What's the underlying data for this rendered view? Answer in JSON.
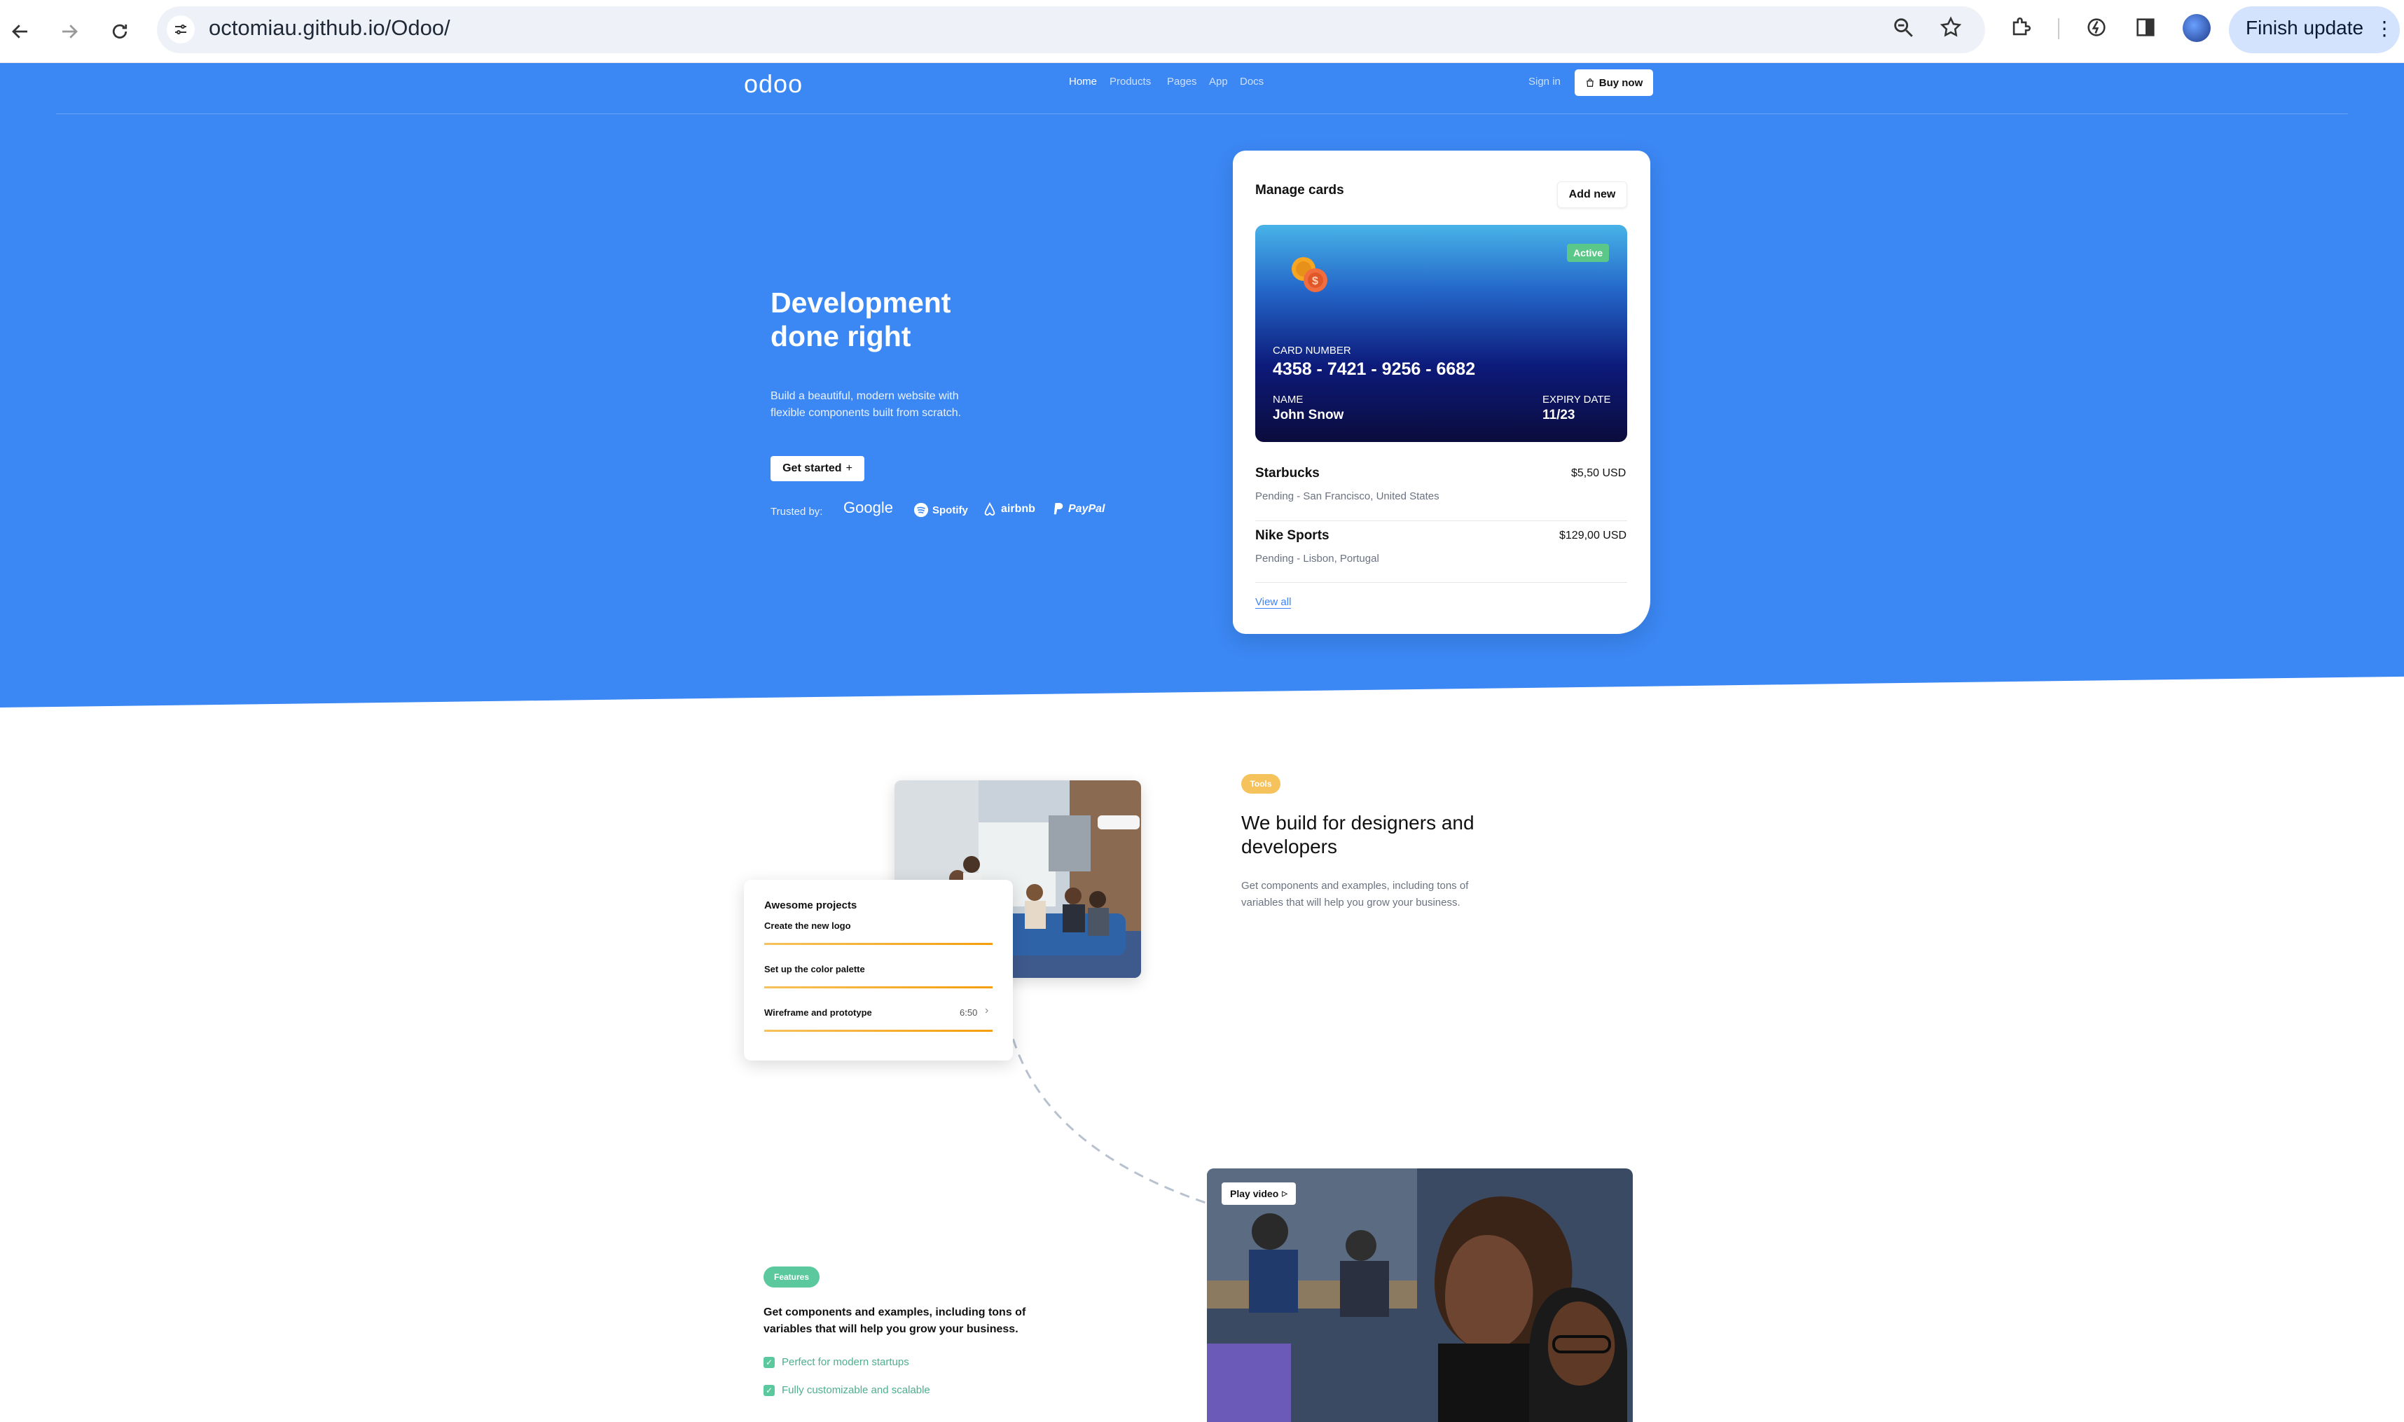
{
  "browser": {
    "url": "octomiau.github.io/Odoo/",
    "finish_update": "Finish update"
  },
  "nav": {
    "logo": "odoo",
    "links": [
      "Home",
      "Products",
      "Pages",
      "App",
      "Docs"
    ],
    "sign_in": "Sign in",
    "buy_now": "Buy now"
  },
  "hero": {
    "title_line1": "Development",
    "title_line2": "done right",
    "subtitle_line1": "Build a beautiful, modern website with",
    "subtitle_line2": "flexible components built from scratch.",
    "cta": "Get started",
    "cta_icon": "+",
    "trusted_label": "Trusted by:",
    "brands": [
      "Google",
      "Spotify",
      "airbnb",
      "PayPal"
    ]
  },
  "manage_cards": {
    "title": "Manage cards",
    "add_new": "Add new",
    "card": {
      "status": "Active",
      "number_label": "CARD NUMBER",
      "number": "4358 - 7421 - 9256 - 6682",
      "name_label": "NAME",
      "name": "John Snow",
      "expiry_label": "EXPIRY DATE",
      "expiry": "11/23"
    },
    "transactions": [
      {
        "merchant": "Starbucks",
        "amount": "$5,50 USD",
        "detail": "Pending - San Francisco, United States"
      },
      {
        "merchant": "Nike Sports",
        "amount": "$129,00 USD",
        "detail": "Pending - Lisbon, Portugal"
      }
    ],
    "view_all": "View all"
  },
  "tools": {
    "badge": "Tools",
    "title_line1": "We build for designers and",
    "title_line2": "developers",
    "desc_line1": "Get components and examples, including tons of",
    "desc_line2": "variables that will help you grow your business."
  },
  "projects": {
    "title": "Awesome projects",
    "items": [
      {
        "label": "Create the new logo"
      },
      {
        "label": "Set up the color palette"
      },
      {
        "label": "Wireframe and prototype",
        "time": "6:50"
      }
    ]
  },
  "features": {
    "badge": "Features",
    "text_line1": "Get components and examples, including tons of",
    "text_line2": "variables that will help you grow your business.",
    "items": [
      "Perfect for modern startups",
      "Fully customizable and scalable"
    ],
    "play_video": "Play video"
  },
  "colors": {
    "hero_blue": "#3b87f3",
    "active_badge": "#5bc88a",
    "tools_badge": "#f6c25c",
    "features_badge": "#5bc89e"
  }
}
